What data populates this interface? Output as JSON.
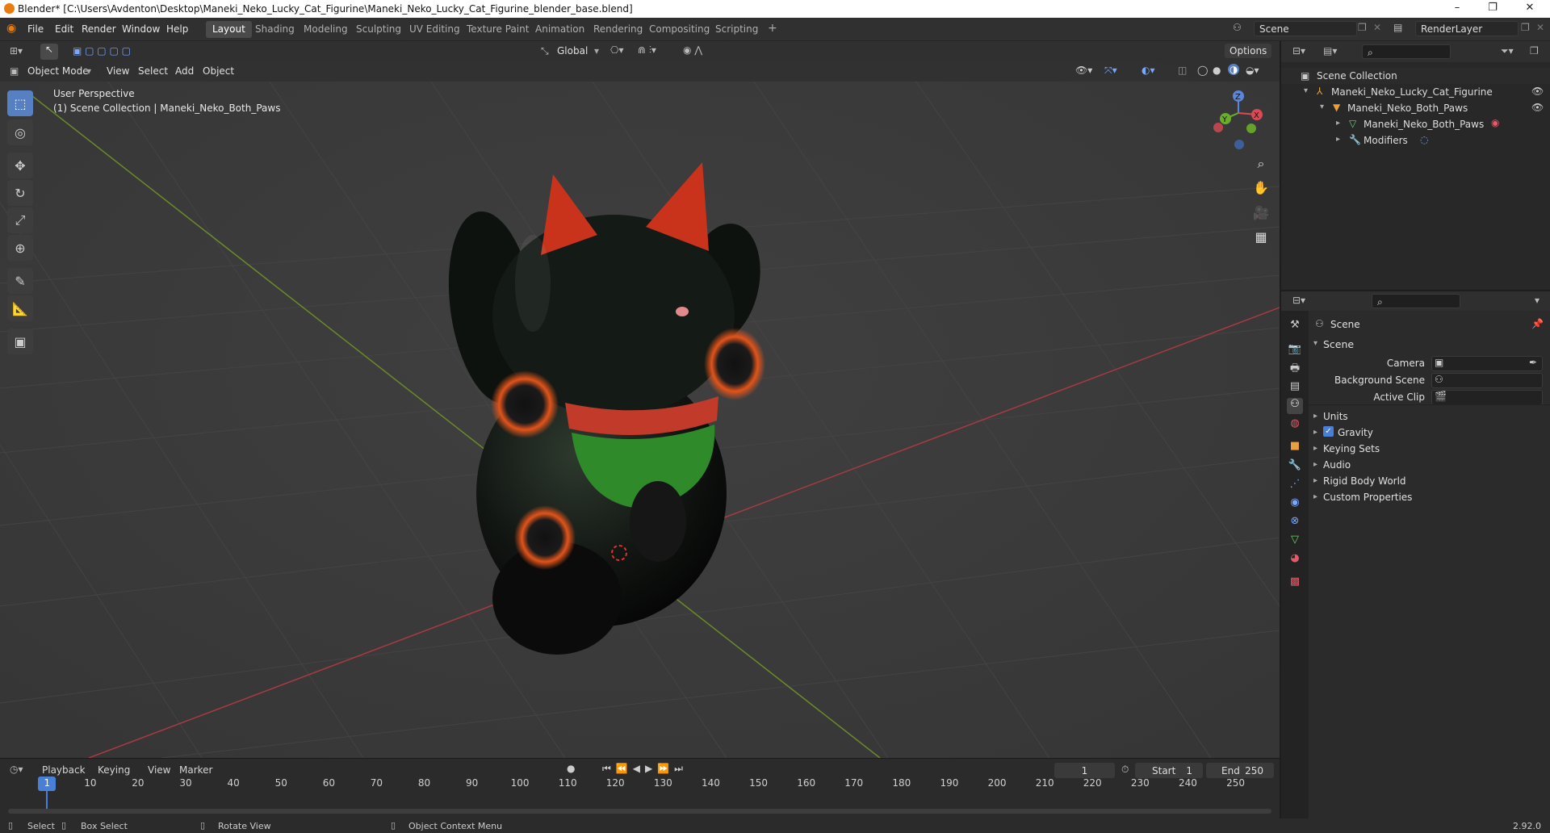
{
  "window": {
    "title": "Blender* [C:\\Users\\Avdenton\\Desktop\\Maneki_Neko_Lucky_Cat_Figurine\\Maneki_Neko_Lucky_Cat_Figurine_blender_base.blend]",
    "minimize": "–",
    "maximize": "❐",
    "close": "✕"
  },
  "menubar": {
    "items": [
      "File",
      "Edit",
      "Render",
      "Window",
      "Help"
    ]
  },
  "workspaces": {
    "tabs": [
      "Layout",
      "Shading",
      "Modeling",
      "Sculpting",
      "UV Editing",
      "Texture Paint",
      "Animation",
      "Rendering",
      "Compositing",
      "Scripting"
    ],
    "active": "Layout",
    "add": "+"
  },
  "scene": {
    "name": "Scene",
    "render_layer": "RenderLayer"
  },
  "viewport": {
    "transform_orientation": "Global",
    "options_label": "Options",
    "mode": "Object Mode",
    "menus": [
      "View",
      "Select",
      "Add",
      "Object"
    ],
    "perspective": "User Perspective",
    "context": "(1) Scene Collection | Maneki_Neko_Both_Paws",
    "gizmo": {
      "x": "X",
      "y": "Y",
      "z": "Z"
    }
  },
  "outliner": {
    "root": "Scene Collection",
    "items": [
      {
        "name": "Maneki_Neko_Lucky_Cat_Figurine",
        "level": 1
      },
      {
        "name": "Maneki_Neko_Both_Paws",
        "level": 2
      },
      {
        "name": "Maneki_Neko_Both_Paws",
        "level": 3
      },
      {
        "name": "Modifiers",
        "level": 3
      }
    ]
  },
  "properties": {
    "header": "Scene",
    "section": "Scene",
    "fields": [
      {
        "label": "Camera",
        "value": ""
      },
      {
        "label": "Background Scene",
        "value": ""
      },
      {
        "label": "Active Clip",
        "value": ""
      }
    ],
    "panels": [
      "Units",
      "Gravity",
      "Keying Sets",
      "Audio",
      "Rigid Body World",
      "Custom Properties"
    ],
    "gravity_checked": true
  },
  "timeline": {
    "menus": [
      "Playback",
      "Keying",
      "View",
      "Marker"
    ],
    "current_frame": "1",
    "start_label": "Start",
    "start": "1",
    "end_label": "End",
    "end": "250",
    "ticks": [
      "1",
      "10",
      "20",
      "30",
      "40",
      "50",
      "60",
      "70",
      "80",
      "90",
      "100",
      "110",
      "120",
      "130",
      "140",
      "150",
      "160",
      "170",
      "180",
      "190",
      "200",
      "210",
      "220",
      "230",
      "240",
      "250"
    ]
  },
  "statusbar": {
    "select": "Select",
    "box_select": "Box Select",
    "rotate_view": "Rotate View",
    "context_menu": "Object Context Menu",
    "version": "2.92.0"
  }
}
